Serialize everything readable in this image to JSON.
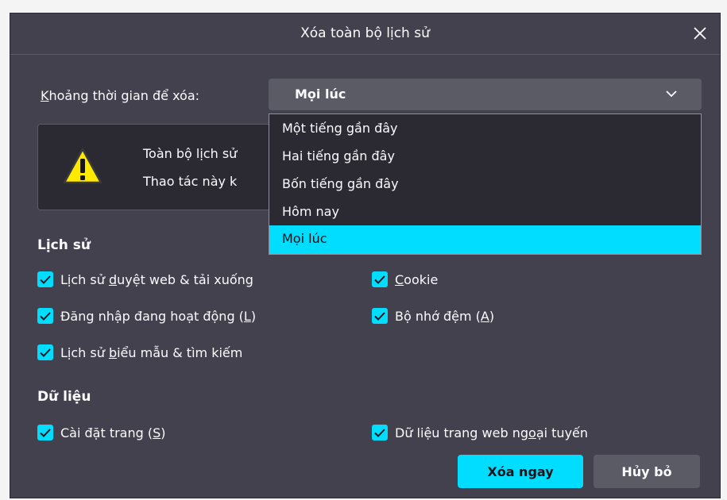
{
  "dialog": {
    "title": "Xóa toàn bộ lịch sử",
    "close_icon": "close-icon"
  },
  "time_range": {
    "label_accesskey": "K",
    "label_rest": "hoảng thời gian để xóa:",
    "selected": "Mọi lúc",
    "options": [
      "Một tiếng gần đây",
      "Hai tiếng gần đây",
      "Bốn tiếng gần đây",
      "Hôm nay",
      "Mọi lúc"
    ]
  },
  "warning": {
    "icon": "warning-icon",
    "line1": "Toàn bộ lịch sử",
    "line2": "Thao tác này k"
  },
  "history": {
    "heading": "Lịch sử",
    "items": {
      "browsing": {
        "pre": "Lịch sử ",
        "key": "d",
        "post": "uyệt web & tải xuống",
        "checked": true
      },
      "cookie": {
        "pre": "",
        "key": "C",
        "post": "ookie",
        "checked": true
      },
      "logins": {
        "pre": "Đăng nhập đang hoạt động (",
        "key": "L",
        "post": ")",
        "checked": true
      },
      "cache": {
        "pre": "Bộ nhớ đệm (",
        "key": "A",
        "post": ")",
        "checked": true
      },
      "forms": {
        "pre": "Lịch sử ",
        "key": "b",
        "post": "iểu mẫu & tìm kiếm",
        "checked": true
      }
    }
  },
  "data": {
    "heading": "Dữ liệu",
    "items": {
      "site_settings": {
        "pre": "Cài đặt trang (",
        "key": "S",
        "post": ")",
        "checked": true
      },
      "offline_data": {
        "pre": "Dữ liệu trang web ng",
        "key": "o",
        "post": "ại tuyến",
        "checked": true
      }
    }
  },
  "buttons": {
    "clear_now": "Xóa ngay",
    "cancel": "Hủy bỏ"
  },
  "colors": {
    "accent": "#00ddff",
    "dialog_bg": "#42414d",
    "panel_bg": "#2b2a33",
    "text": "#fbfbfe"
  }
}
